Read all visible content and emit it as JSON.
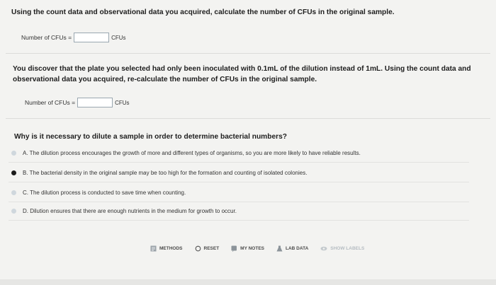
{
  "q1": {
    "text": "Using the count data and observational data you acquired, calculate the number of CFUs in the original sample.",
    "label": "Number of CFUs =",
    "value": "",
    "unit": "CFUs"
  },
  "q2": {
    "line1": "You discover that the plate you selected had only been inoculated with 0.1mL of the dilution instead of 1mL. Using the count data and",
    "line2": "observational data you acquired, re-calculate the number of CFUs in the original sample.",
    "label": "Number of CFUs =",
    "value": "",
    "unit": "CFUs"
  },
  "q3": {
    "text": "Why is it necessary to dilute a sample in order to determine bacterial numbers?",
    "choices": [
      {
        "label": "A. The dilution process encourages the growth of more and different types of organisms, so you are more likely to have reliable results.",
        "selected": false
      },
      {
        "label": "B. The bacterial density in the original sample may be too high for the formation and counting of isolated colonies.",
        "selected": true
      },
      {
        "label": "C. The dilution process is conducted to save time when counting.",
        "selected": false
      },
      {
        "label": "D. Dilution ensures that there are enough nutrients in the medium for growth to occur.",
        "selected": false
      }
    ]
  },
  "toolbar": {
    "methods": "METHODS",
    "reset": "RESET",
    "my_notes": "MY NOTES",
    "lab_data": "LAB DATA",
    "show_labels": "SHOW LABELS"
  }
}
